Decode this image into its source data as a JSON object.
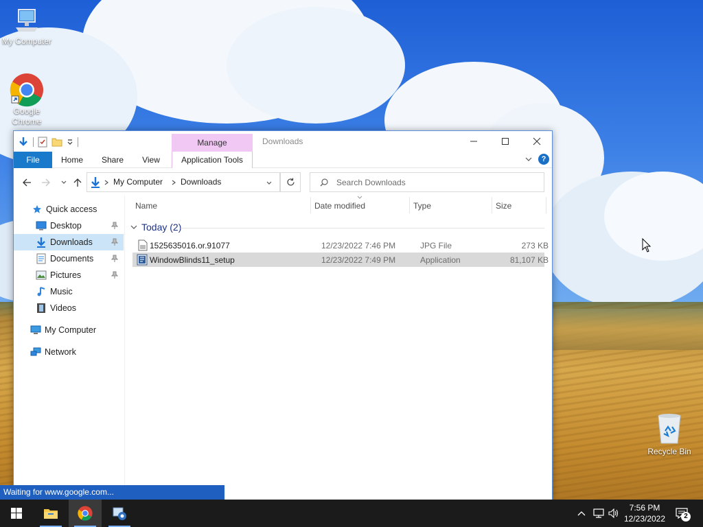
{
  "desktop": {
    "icons": [
      {
        "label": "My Computer"
      },
      {
        "label": "Google\nChrome"
      },
      {
        "label": "Recycle Bin"
      }
    ]
  },
  "window": {
    "title": "Downloads",
    "context_tab": "Manage",
    "ribbon_tabs": [
      "File",
      "Home",
      "Share",
      "View",
      "Application Tools"
    ],
    "help_label": "?",
    "address": {
      "root": "My Computer",
      "current": "Downloads"
    },
    "search_placeholder": "Search Downloads",
    "nav_pane": [
      {
        "label": "Quick access",
        "icon": "star-icon"
      },
      {
        "label": "Desktop",
        "icon": "desktop-icon",
        "pinned": true
      },
      {
        "label": "Downloads",
        "icon": "download-arrow-icon",
        "pinned": true,
        "selected": true
      },
      {
        "label": "Documents",
        "icon": "documents-icon",
        "pinned": true
      },
      {
        "label": "Pictures",
        "icon": "pictures-icon",
        "pinned": true
      },
      {
        "label": "Music",
        "icon": "music-icon"
      },
      {
        "label": "Videos",
        "icon": "videos-icon"
      },
      {
        "label": "My Computer",
        "icon": "computer-icon"
      },
      {
        "label": "Network",
        "icon": "network-icon"
      }
    ],
    "columns": [
      "Name",
      "Date modified",
      "Type",
      "Size"
    ],
    "group": {
      "label": "Today (2)"
    },
    "files": [
      {
        "name": "1525635016.or.91077",
        "date": "12/23/2022 7:46 PM",
        "type": "JPG File",
        "size": "273 KB",
        "selected": false
      },
      {
        "name": "WindowBlinds11_setup",
        "date": "12/23/2022 7:49 PM",
        "type": "Application",
        "size": "81,107 KB",
        "selected": true
      }
    ]
  },
  "status_tooltip": "Waiting for www.google.com...",
  "taskbar": {
    "time": "7:56 PM",
    "date": "12/23/2022",
    "notification_count": "2"
  },
  "colors": {
    "accent": "#1979ca",
    "selection": "#cce4f7",
    "context_tab": "#f1c8f3",
    "taskbar": "#1b1b1b"
  }
}
